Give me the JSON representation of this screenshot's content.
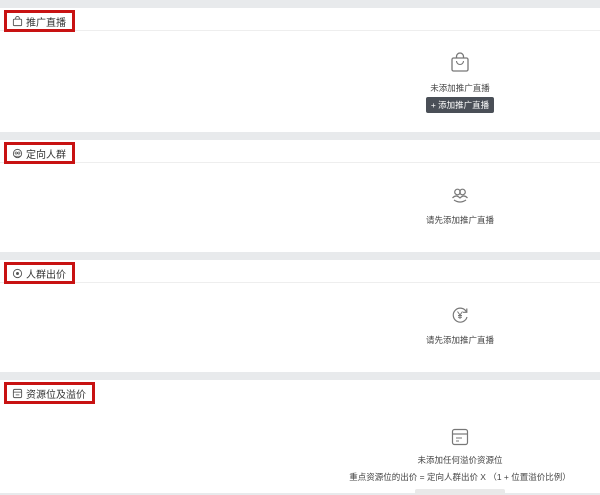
{
  "sections": [
    {
      "title": "推广直播",
      "icon": "shopping-bag-icon",
      "empty_text": "未添加推广直播",
      "button_label": "+ 添加推广直播"
    },
    {
      "title": "定向人群",
      "icon": "people-group-icon",
      "empty_text": "请先添加推广直播"
    },
    {
      "title": "人群出价",
      "icon": "target-icon",
      "empty_text": "请先添加推广直播"
    },
    {
      "title": "资源位及溢价",
      "icon": "resource-slot-icon",
      "empty_text": "未添加任何溢价资源位",
      "formula_text": "重点资源位的出价 = 定向人群出价 X （1 + 位置溢价比例）"
    }
  ],
  "colors": {
    "highlight_border": "#c81212",
    "button_bg": "#4a4f57",
    "page_bg": "#e8eaec"
  }
}
